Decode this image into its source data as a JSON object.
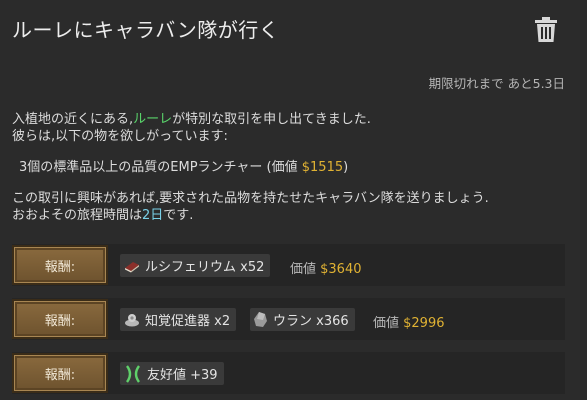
{
  "window": {
    "title": "ルーレにキャラバン隊が行く"
  },
  "expiry": {
    "text": "期限切れまで あと5.3日"
  },
  "description": {
    "line1_prefix": "入植地の近くにある,",
    "settlement_name": "ルーレ",
    "line1_suffix": "が特別な取引を申し出てきました.",
    "line2": "彼らは,以下の物を欲しがっています:",
    "request_text": "3個の標準品以上の品質のEMPランチャー (価値 ",
    "request_value": "$1515",
    "request_close": ")",
    "line3": "この取引に興味があれば,要求された品物を持たせたキャラバン隊を送りましょう.",
    "line4_prefix": "おおよその旅程時間は",
    "travel_days": "2日",
    "line4_suffix": "です."
  },
  "rewards": [
    {
      "button_label": "報酬:",
      "items": [
        {
          "icon": "book-icon",
          "label": "ルシフェリウム x52"
        }
      ],
      "price_label": "価値 ",
      "price_value": "$3640"
    },
    {
      "button_label": "報酬:",
      "items": [
        {
          "icon": "psychic-booster-icon",
          "label": "知覚促進器 x2"
        },
        {
          "icon": "uranium-icon",
          "label": "ウラン x366"
        }
      ],
      "price_label": "価値 ",
      "price_value": "$2996"
    },
    {
      "button_label": "報酬:",
      "items": [
        {
          "icon": "goodwill-icon",
          "label": "友好値 +39"
        }
      ]
    }
  ],
  "colors": {
    "settlement": "#59d36a",
    "value": "#e0b233",
    "days": "#7ad1e8",
    "button": "#7b5d35"
  }
}
